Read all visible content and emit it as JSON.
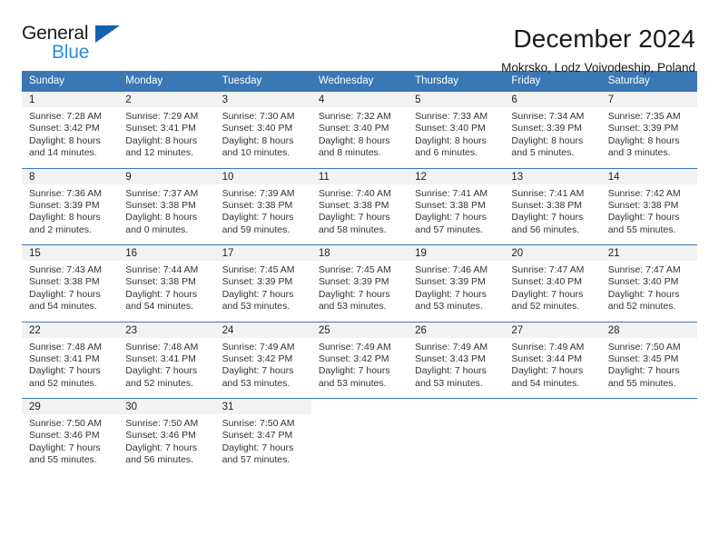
{
  "logo": {
    "primary_text": "General",
    "secondary_text": "Blue",
    "triangle_icon": "triangle-icon",
    "primary_color": "#1a1a1a",
    "secondary_color": "#2a8fdd",
    "triangle_color": "#1263ad"
  },
  "header": {
    "title": "December 2024",
    "subtitle": "Mokrsko, Lodz Voivodeship, Poland"
  },
  "theme": {
    "header_blue": "#3a78b5",
    "daynum_band": "#f2f2f2",
    "cell_text": "#333333",
    "page_background": "#ffffff"
  },
  "calendar": {
    "weekdays": [
      "Sunday",
      "Monday",
      "Tuesday",
      "Wednesday",
      "Thursday",
      "Friday",
      "Saturday"
    ],
    "weeks": [
      [
        {
          "day": "1",
          "sunrise": "Sunrise: 7:28 AM",
          "sunset": "Sunset: 3:42 PM",
          "daylight1": "Daylight: 8 hours",
          "daylight2": "and 14 minutes."
        },
        {
          "day": "2",
          "sunrise": "Sunrise: 7:29 AM",
          "sunset": "Sunset: 3:41 PM",
          "daylight1": "Daylight: 8 hours",
          "daylight2": "and 12 minutes."
        },
        {
          "day": "3",
          "sunrise": "Sunrise: 7:30 AM",
          "sunset": "Sunset: 3:40 PM",
          "daylight1": "Daylight: 8 hours",
          "daylight2": "and 10 minutes."
        },
        {
          "day": "4",
          "sunrise": "Sunrise: 7:32 AM",
          "sunset": "Sunset: 3:40 PM",
          "daylight1": "Daylight: 8 hours",
          "daylight2": "and 8 minutes."
        },
        {
          "day": "5",
          "sunrise": "Sunrise: 7:33 AM",
          "sunset": "Sunset: 3:40 PM",
          "daylight1": "Daylight: 8 hours",
          "daylight2": "and 6 minutes."
        },
        {
          "day": "6",
          "sunrise": "Sunrise: 7:34 AM",
          "sunset": "Sunset: 3:39 PM",
          "daylight1": "Daylight: 8 hours",
          "daylight2": "and 5 minutes."
        },
        {
          "day": "7",
          "sunrise": "Sunrise: 7:35 AM",
          "sunset": "Sunset: 3:39 PM",
          "daylight1": "Daylight: 8 hours",
          "daylight2": "and 3 minutes."
        }
      ],
      [
        {
          "day": "8",
          "sunrise": "Sunrise: 7:36 AM",
          "sunset": "Sunset: 3:39 PM",
          "daylight1": "Daylight: 8 hours",
          "daylight2": "and 2 minutes."
        },
        {
          "day": "9",
          "sunrise": "Sunrise: 7:37 AM",
          "sunset": "Sunset: 3:38 PM",
          "daylight1": "Daylight: 8 hours",
          "daylight2": "and 0 minutes."
        },
        {
          "day": "10",
          "sunrise": "Sunrise: 7:39 AM",
          "sunset": "Sunset: 3:38 PM",
          "daylight1": "Daylight: 7 hours",
          "daylight2": "and 59 minutes."
        },
        {
          "day": "11",
          "sunrise": "Sunrise: 7:40 AM",
          "sunset": "Sunset: 3:38 PM",
          "daylight1": "Daylight: 7 hours",
          "daylight2": "and 58 minutes."
        },
        {
          "day": "12",
          "sunrise": "Sunrise: 7:41 AM",
          "sunset": "Sunset: 3:38 PM",
          "daylight1": "Daylight: 7 hours",
          "daylight2": "and 57 minutes."
        },
        {
          "day": "13",
          "sunrise": "Sunrise: 7:41 AM",
          "sunset": "Sunset: 3:38 PM",
          "daylight1": "Daylight: 7 hours",
          "daylight2": "and 56 minutes."
        },
        {
          "day": "14",
          "sunrise": "Sunrise: 7:42 AM",
          "sunset": "Sunset: 3:38 PM",
          "daylight1": "Daylight: 7 hours",
          "daylight2": "and 55 minutes."
        }
      ],
      [
        {
          "day": "15",
          "sunrise": "Sunrise: 7:43 AM",
          "sunset": "Sunset: 3:38 PM",
          "daylight1": "Daylight: 7 hours",
          "daylight2": "and 54 minutes."
        },
        {
          "day": "16",
          "sunrise": "Sunrise: 7:44 AM",
          "sunset": "Sunset: 3:38 PM",
          "daylight1": "Daylight: 7 hours",
          "daylight2": "and 54 minutes."
        },
        {
          "day": "17",
          "sunrise": "Sunrise: 7:45 AM",
          "sunset": "Sunset: 3:39 PM",
          "daylight1": "Daylight: 7 hours",
          "daylight2": "and 53 minutes."
        },
        {
          "day": "18",
          "sunrise": "Sunrise: 7:45 AM",
          "sunset": "Sunset: 3:39 PM",
          "daylight1": "Daylight: 7 hours",
          "daylight2": "and 53 minutes."
        },
        {
          "day": "19",
          "sunrise": "Sunrise: 7:46 AM",
          "sunset": "Sunset: 3:39 PM",
          "daylight1": "Daylight: 7 hours",
          "daylight2": "and 53 minutes."
        },
        {
          "day": "20",
          "sunrise": "Sunrise: 7:47 AM",
          "sunset": "Sunset: 3:40 PM",
          "daylight1": "Daylight: 7 hours",
          "daylight2": "and 52 minutes."
        },
        {
          "day": "21",
          "sunrise": "Sunrise: 7:47 AM",
          "sunset": "Sunset: 3:40 PM",
          "daylight1": "Daylight: 7 hours",
          "daylight2": "and 52 minutes."
        }
      ],
      [
        {
          "day": "22",
          "sunrise": "Sunrise: 7:48 AM",
          "sunset": "Sunset: 3:41 PM",
          "daylight1": "Daylight: 7 hours",
          "daylight2": "and 52 minutes."
        },
        {
          "day": "23",
          "sunrise": "Sunrise: 7:48 AM",
          "sunset": "Sunset: 3:41 PM",
          "daylight1": "Daylight: 7 hours",
          "daylight2": "and 52 minutes."
        },
        {
          "day": "24",
          "sunrise": "Sunrise: 7:49 AM",
          "sunset": "Sunset: 3:42 PM",
          "daylight1": "Daylight: 7 hours",
          "daylight2": "and 53 minutes."
        },
        {
          "day": "25",
          "sunrise": "Sunrise: 7:49 AM",
          "sunset": "Sunset: 3:42 PM",
          "daylight1": "Daylight: 7 hours",
          "daylight2": "and 53 minutes."
        },
        {
          "day": "26",
          "sunrise": "Sunrise: 7:49 AM",
          "sunset": "Sunset: 3:43 PM",
          "daylight1": "Daylight: 7 hours",
          "daylight2": "and 53 minutes."
        },
        {
          "day": "27",
          "sunrise": "Sunrise: 7:49 AM",
          "sunset": "Sunset: 3:44 PM",
          "daylight1": "Daylight: 7 hours",
          "daylight2": "and 54 minutes."
        },
        {
          "day": "28",
          "sunrise": "Sunrise: 7:50 AM",
          "sunset": "Sunset: 3:45 PM",
          "daylight1": "Daylight: 7 hours",
          "daylight2": "and 55 minutes."
        }
      ],
      [
        {
          "day": "29",
          "sunrise": "Sunrise: 7:50 AM",
          "sunset": "Sunset: 3:46 PM",
          "daylight1": "Daylight: 7 hours",
          "daylight2": "and 55 minutes."
        },
        {
          "day": "30",
          "sunrise": "Sunrise: 7:50 AM",
          "sunset": "Sunset: 3:46 PM",
          "daylight1": "Daylight: 7 hours",
          "daylight2": "and 56 minutes."
        },
        {
          "day": "31",
          "sunrise": "Sunrise: 7:50 AM",
          "sunset": "Sunset: 3:47 PM",
          "daylight1": "Daylight: 7 hours",
          "daylight2": "and 57 minutes."
        },
        {
          "day": "",
          "sunrise": "",
          "sunset": "",
          "daylight1": "",
          "daylight2": ""
        },
        {
          "day": "",
          "sunrise": "",
          "sunset": "",
          "daylight1": "",
          "daylight2": ""
        },
        {
          "day": "",
          "sunrise": "",
          "sunset": "",
          "daylight1": "",
          "daylight2": ""
        },
        {
          "day": "",
          "sunrise": "",
          "sunset": "",
          "daylight1": "",
          "daylight2": ""
        }
      ]
    ]
  }
}
